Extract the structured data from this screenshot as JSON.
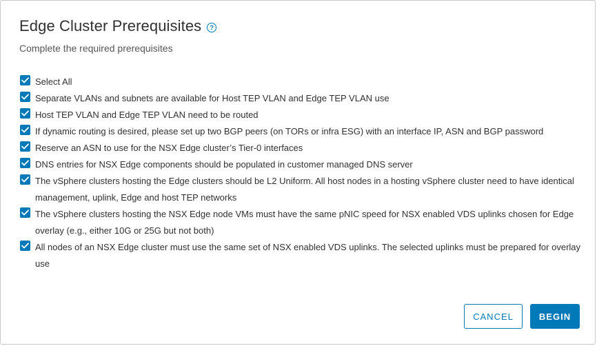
{
  "dialog": {
    "title": "Edge Cluster Prerequisites",
    "help_icon": "?",
    "subtitle": "Complete the required prerequisites"
  },
  "prerequisites": [
    {
      "label": "Select All",
      "checked": true
    },
    {
      "label": "Separate VLANs and subnets are available for Host TEP VLAN and Edge TEP VLAN use",
      "checked": true
    },
    {
      "label": "Host TEP VLAN and Edge TEP VLAN need to be routed",
      "checked": true
    },
    {
      "label": "If dynamic routing is desired, please set up two BGP peers (on TORs or infra ESG) with an interface IP, ASN and BGP password",
      "checked": true
    },
    {
      "label": "Reserve an ASN to use for the NSX Edge cluster’s Tier-0 interfaces",
      "checked": true
    },
    {
      "label": "DNS entries for NSX Edge components should be populated in customer managed DNS server",
      "checked": true
    },
    {
      "label": "The vSphere clusters hosting the Edge clusters should be L2 Uniform. All host nodes in a hosting vSphere cluster need to have identical management, uplink, Edge and host TEP networks",
      "checked": true
    },
    {
      "label": "The vSphere clusters hosting the NSX Edge node VMs must have the same pNIC speed for NSX enabled VDS uplinks chosen for Edge overlay (e.g., either 10G or 25G but not both)",
      "checked": true
    },
    {
      "label": "All nodes of an NSX Edge cluster must use the same set of NSX enabled VDS uplinks. The selected uplinks must be prepared for overlay use",
      "checked": true
    }
  ],
  "footer": {
    "cancel_label": "CANCEL",
    "begin_label": "BEGIN"
  },
  "colors": {
    "accent": "#0079b8"
  }
}
